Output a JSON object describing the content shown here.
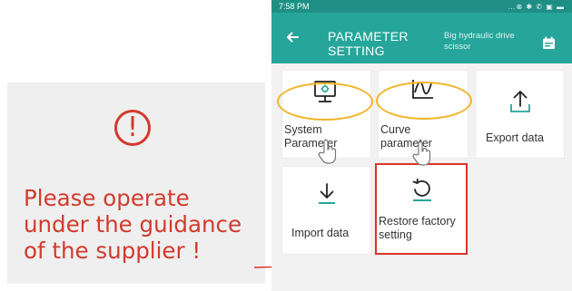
{
  "warning": {
    "icon_glyph": "!",
    "lines": [
      "Please operate",
      "under the guidance",
      "of the supplier !"
    ],
    "color": "#d33a2c"
  },
  "status_bar": {
    "time": "7:58 PM",
    "icons_text": "…⊗ ✱ ✆ ▣ ▬"
  },
  "app_bar": {
    "title": "PARAMETER SETTING",
    "subtitle": "Big hydraulic drive scissor",
    "color": "#26a69a",
    "back_icon": "arrow-left-icon",
    "action_icon": "calendar-icon"
  },
  "tiles": [
    {
      "label": "System Parameter",
      "icon": "monitor-gear-icon"
    },
    {
      "label": "Curve parameter",
      "icon": "curve-chart-icon"
    },
    {
      "label": "Export data",
      "icon": "upload-icon"
    },
    {
      "label": "Import data",
      "icon": "download-icon"
    },
    {
      "label": "Restore factory setting",
      "icon": "restore-icon"
    }
  ],
  "highlight_colors": {
    "ellipse": "#f2b527",
    "restore_box": "#e0332a"
  }
}
